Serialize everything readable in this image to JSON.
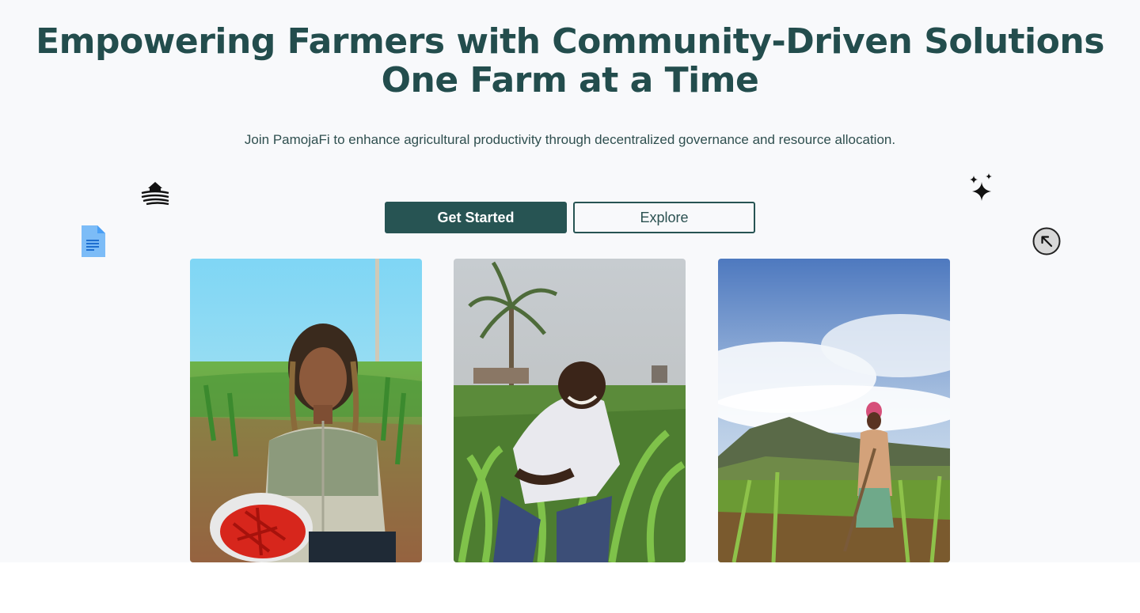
{
  "hero": {
    "headline_line1": "Empowering Farmers with Community-Driven Solutions",
    "headline_line2": "One Farm at a Time",
    "subtitle": "Join PamojaFi to enhance agricultural productivity through decentralized governance and resource allocation."
  },
  "actions": {
    "primary_label": "Get Started",
    "secondary_label": "Explore"
  },
  "decorations": {
    "icons": [
      "farm-barn-icon",
      "document-icon",
      "sparkles-icon",
      "arrow-up-left-circle-icon"
    ]
  },
  "gallery": {
    "photos": [
      {
        "subject": "farmer-holding-red-chili-peppers"
      },
      {
        "subject": "farmer-tending-maize-seedlings"
      },
      {
        "subject": "farmer-standing-in-field-with-hoe"
      }
    ]
  },
  "colors": {
    "brand_primary": "#275453",
    "headline": "#234d4d",
    "background": "#f8f9fb",
    "document_icon": "#4a9ff5"
  }
}
